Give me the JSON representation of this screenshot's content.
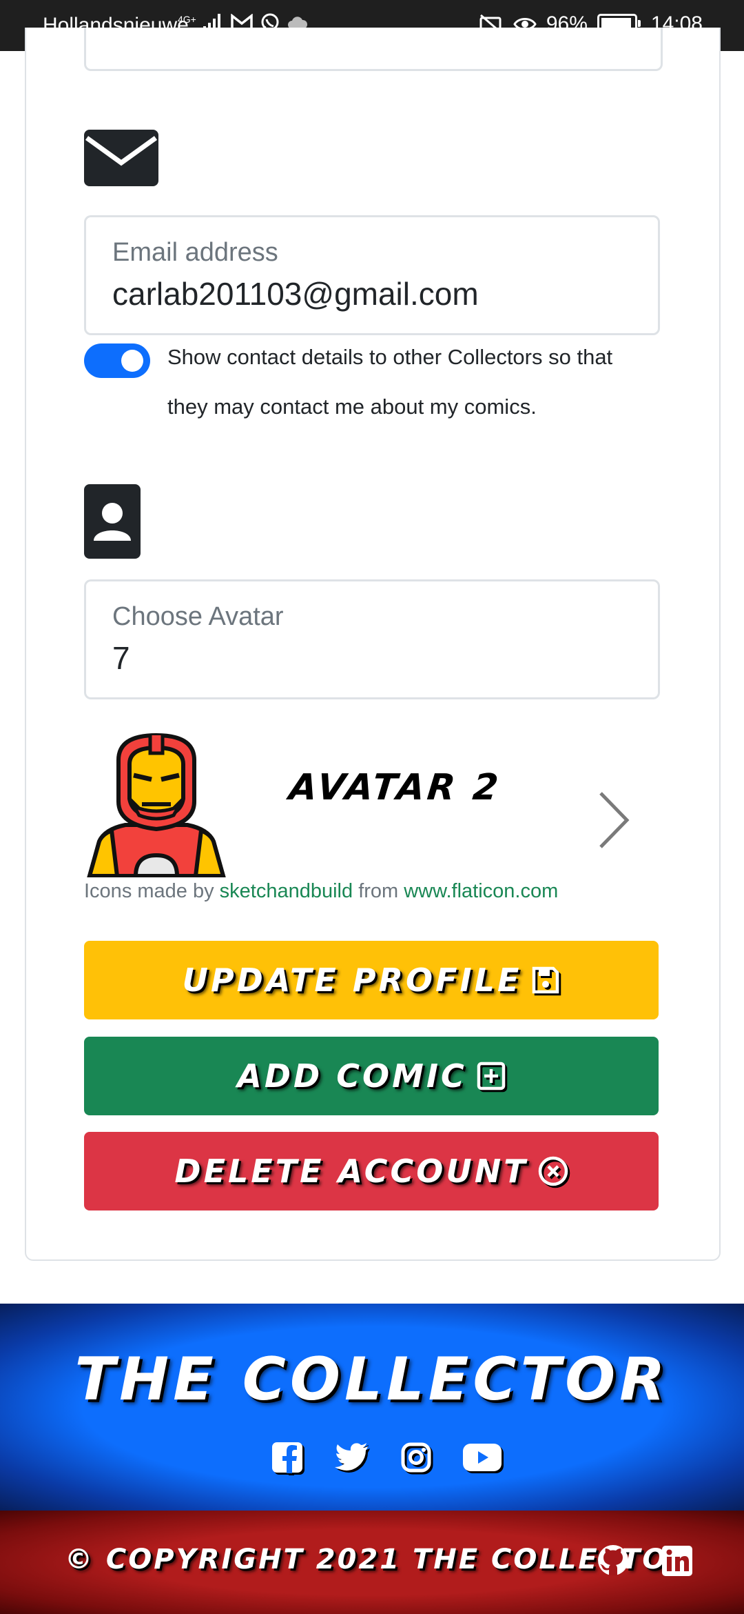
{
  "status_bar": {
    "carrier": "Hollandsnieuwe",
    "network": "4G+",
    "battery": "96%",
    "time": "14:08"
  },
  "contact": {
    "email_label": "Email address",
    "email_value": "carlab201103@gmail.com",
    "share_toggle_on": true,
    "share_text": "Show contact details to other Collectors so that they may contact me about my comics."
  },
  "avatar": {
    "select_label": "Choose Avatar",
    "select_value": "7",
    "caption": "AVATAR 2",
    "credit_prefix": "Icons made by ",
    "credit_author": "sketchandbuild",
    "credit_middle": " from ",
    "credit_site": "www.flaticon.com"
  },
  "actions": {
    "update_label": "UPDATE PROFILE",
    "add_label": "ADD COMIC",
    "delete_label": "DELETE ACCOUNT"
  },
  "footer": {
    "brand": "THE COLLECTOR",
    "copyright": "© COPYRIGHT 2021 THE COLLECTOR"
  },
  "colors": {
    "primary": "#0d6efd",
    "warning": "#ffc107",
    "success": "#198754",
    "danger": "#dc3545",
    "footer_red": "#b11c1c"
  },
  "icons": [
    "envelope-icon",
    "person-badge-icon",
    "chevron-right-icon",
    "save-icon",
    "plus-square-icon",
    "x-circle-icon",
    "facebook-icon",
    "twitter-icon",
    "instagram-icon",
    "youtube-icon",
    "github-icon",
    "linkedin-icon"
  ]
}
